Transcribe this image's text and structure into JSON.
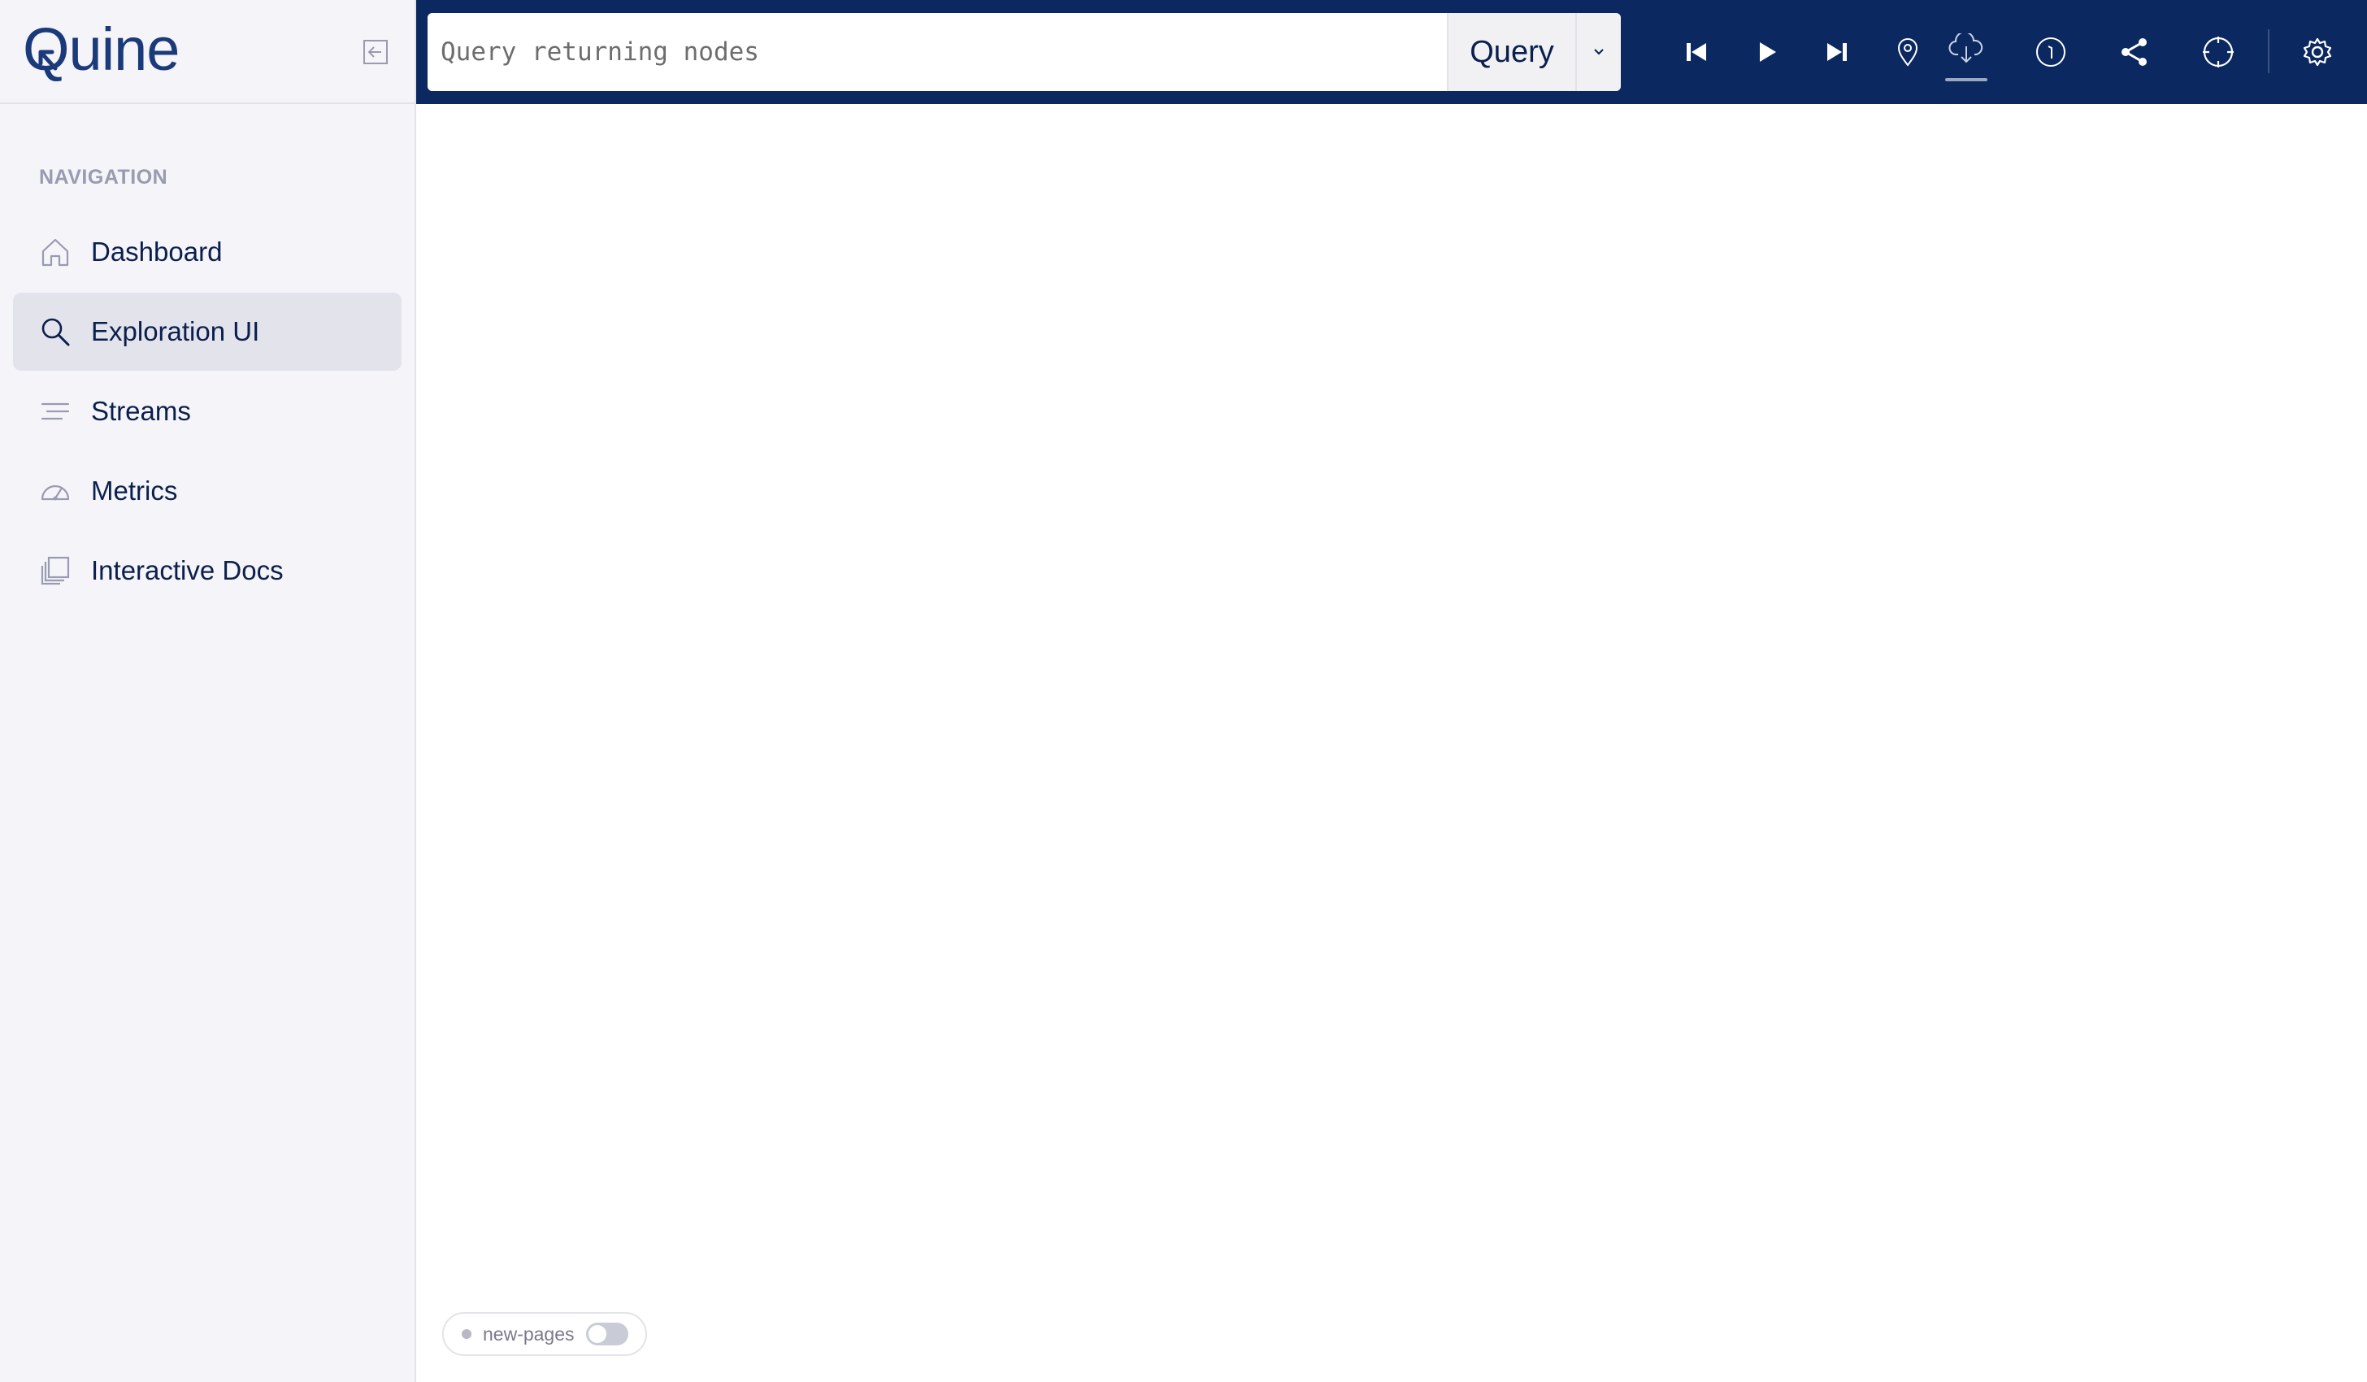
{
  "brand": {
    "logo_text": "Quine"
  },
  "sidebar": {
    "heading": "NAVIGATION",
    "items": [
      {
        "label": "Dashboard",
        "icon": "home-icon",
        "active": false
      },
      {
        "label": "Exploration UI",
        "icon": "search-icon",
        "active": true
      },
      {
        "label": "Streams",
        "icon": "streams-icon",
        "active": false
      },
      {
        "label": "Metrics",
        "icon": "gauge-icon",
        "active": false
      },
      {
        "label": "Interactive Docs",
        "icon": "docs-icon",
        "active": false
      }
    ]
  },
  "topbar": {
    "query_placeholder": "Query returning nodes",
    "query_button": "Query",
    "tools": [
      "skip-back-icon",
      "play-icon",
      "skip-forward-icon",
      "location-pin-icon",
      "cloud-download-icon",
      "info-icon",
      "share-icon",
      "crosshair-icon",
      "settings-icon"
    ]
  },
  "feature_flag": {
    "label": "new-pages",
    "enabled": false
  },
  "colors": {
    "topbar": "#0b2960",
    "sidebar": "#f4f4f9",
    "text": "#0b1f4d",
    "muted": "#9a9ab0"
  }
}
